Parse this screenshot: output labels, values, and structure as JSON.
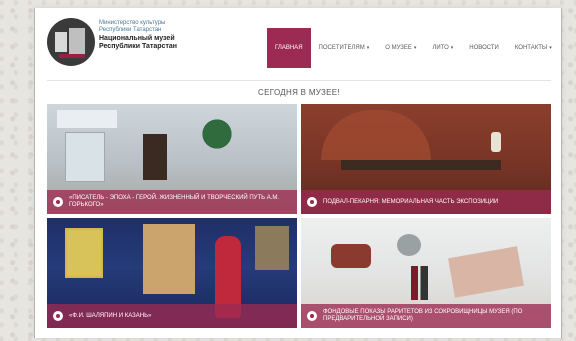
{
  "header": {
    "logo_alt": "Museum logo",
    "ministry_line1": "Министерство культуры",
    "ministry_line2": "Республики Татарстан",
    "museum_line1": "Национальный музей",
    "museum_line2": "Республики Татарстан"
  },
  "nav": {
    "items": [
      {
        "label": "ГЛАВНАЯ",
        "active": true,
        "has_caret": false
      },
      {
        "label": "ПОСЕТИТЕЛЯМ",
        "active": false,
        "has_caret": true
      },
      {
        "label": "О МУЗЕЕ",
        "active": false,
        "has_caret": true
      },
      {
        "label": "ЛИТО",
        "active": false,
        "has_caret": true
      },
      {
        "label": "НОВОСТИ",
        "active": false,
        "has_caret": false
      },
      {
        "label": "КОНТАКТЫ",
        "active": false,
        "has_caret": true
      }
    ]
  },
  "main": {
    "section_title": "СЕГОДНЯ В МУЗЕЕ!",
    "tiles": [
      {
        "caption": "«ПИСАТЕЛЬ - ЭПОХА - ГЕРОЙ. ЖИЗНЕННЫЙ И ТВОРЧЕСКИЙ ПУТЬ А.М. ГОРЬКОГО»"
      },
      {
        "caption": "ПОДВАЛ-ПЕКАРНЯ: МЕМОРИАЛЬНАЯ ЧАСТЬ ЭКСПОЗИЦИИ"
      },
      {
        "caption": "«Ф.И. ШАЛЯПИН И КАЗАНЬ»"
      },
      {
        "caption": "ФОНДОВЫЕ ПОКАЗЫ РАРИТЕТОВ ИЗ СОКРОВИЩНИЦЫ МУЗЕЯ (ПО ПРЕДВАРИТЕЛЬНОЙ ЗАПИСИ)"
      }
    ]
  },
  "colors": {
    "accent": "#9c2a52",
    "ministry_text": "#4b7a9a"
  }
}
